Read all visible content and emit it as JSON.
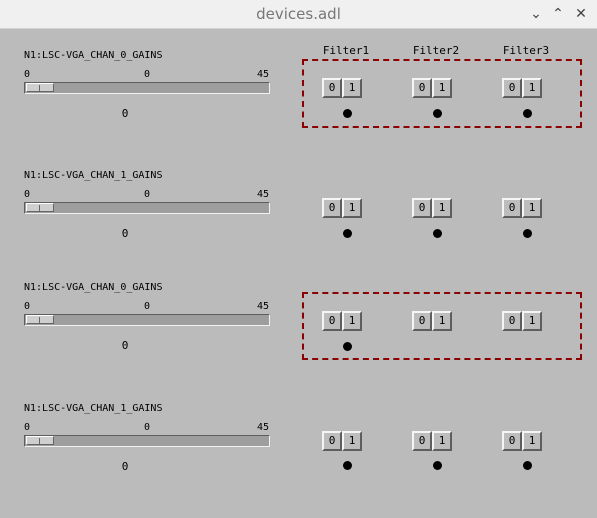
{
  "window": {
    "title": "devices.adl"
  },
  "titlebar_buttons": [
    {
      "icon": "chevron-down-icon",
      "glyph": "⌄"
    },
    {
      "icon": "chevron-up-icon",
      "glyph": "⌃"
    },
    {
      "icon": "close-icon",
      "glyph": "✕"
    }
  ],
  "filter_headers": [
    "Filter1",
    "Filter2",
    "Filter3"
  ],
  "panels": [
    {
      "pv": "N1:LSC-VGA_CHAN_0_GAINS",
      "tick_min": "0",
      "tick_mid": "0",
      "tick_max": "45",
      "slider_value_fraction": 0,
      "value": "0",
      "filters": [
        {
          "btn0": "0",
          "btn1": "1"
        },
        {
          "btn0": "0",
          "btn1": "1"
        },
        {
          "btn0": "0",
          "btn1": "1"
        }
      ]
    },
    {
      "pv": "N1:LSC-VGA_CHAN_1_GAINS",
      "tick_min": "0",
      "tick_mid": "0",
      "tick_max": "45",
      "slider_value_fraction": 0,
      "value": "0",
      "filters": [
        {
          "btn0": "0",
          "btn1": "1"
        },
        {
          "btn0": "0",
          "btn1": "1"
        },
        {
          "btn0": "0",
          "btn1": "1"
        }
      ]
    },
    {
      "pv": "N1:LSC-VGA_CHAN_0_GAINS",
      "tick_min": "0",
      "tick_mid": "0",
      "tick_max": "45",
      "slider_value_fraction": 0,
      "value": "0",
      "filters": [
        {
          "btn0": "0",
          "btn1": "1"
        },
        {
          "btn0": "0",
          "btn1": "1"
        },
        {
          "btn0": "0",
          "btn1": "1"
        }
      ]
    },
    {
      "pv": "N1:LSC-VGA_CHAN_1_GAINS",
      "tick_min": "0",
      "tick_mid": "0",
      "tick_max": "45",
      "slider_value_fraction": 0,
      "value": "0",
      "filters": [
        {
          "btn0": "0",
          "btn1": "1"
        },
        {
          "btn0": "0",
          "btn1": "1"
        },
        {
          "btn0": "0",
          "btn1": "1"
        }
      ]
    }
  ],
  "colors": {
    "background": "#bbbbbb",
    "highlight_border": "#8b0000",
    "led": "#000000"
  }
}
